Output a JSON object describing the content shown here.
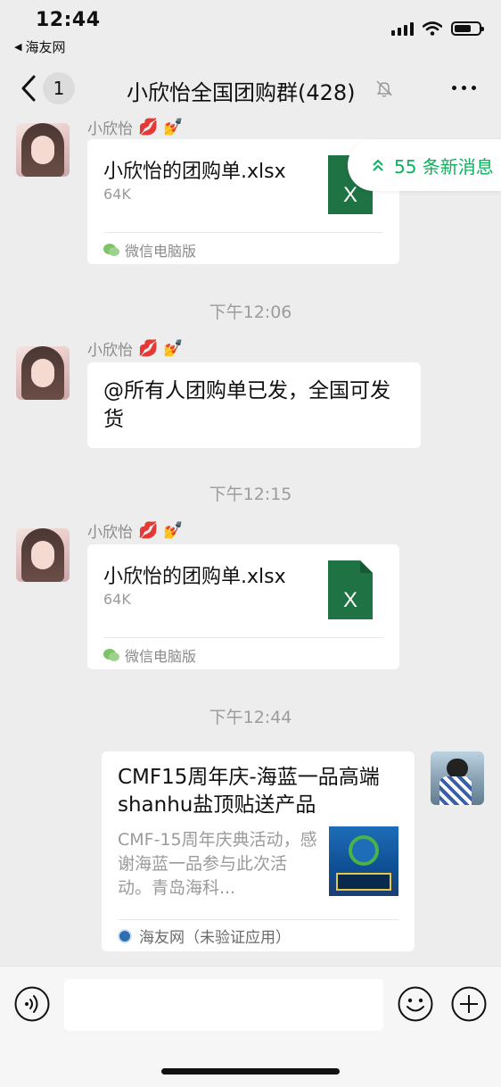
{
  "status_bar": {
    "time": "12:44",
    "back_app": "海友网",
    "back_app_icon": "left-triangle-icon",
    "icons": [
      "signal-icon",
      "wifi-icon",
      "battery-icon"
    ]
  },
  "nav": {
    "unread_count": "1",
    "title": "小欣怡全国团购群(428)",
    "mute_icon": "bell-off-icon",
    "more_icon": "more-icon"
  },
  "new_messages": {
    "label": "55 条新消息",
    "color": "#07b35a"
  },
  "messages": [
    {
      "type": "file",
      "sender": "小欣怡",
      "emojis": "💋 💅",
      "file_name": "小欣怡的团购单.xlsx",
      "file_size": "64K",
      "source": "微信电脑版"
    },
    {
      "type": "time",
      "text": "下午12:06"
    },
    {
      "type": "text",
      "sender": "小欣怡",
      "emojis": "💋 💅",
      "text": "@所有人团购单已发，全国可发货"
    },
    {
      "type": "time",
      "text": "下午12:15"
    },
    {
      "type": "file",
      "sender": "小欣怡",
      "emojis": "💋 💅",
      "file_name": "小欣怡的团购单.xlsx",
      "file_size": "64K",
      "source": "微信电脑版"
    },
    {
      "type": "time",
      "text": "下午12:44"
    },
    {
      "type": "link",
      "from_self": true,
      "title": "CMF15周年庆-海蓝一品高端shanhu盐顶贴送产品",
      "description": "CMF-15周年庆典活动，感谢海蓝一品参与此次活动。青岛海科...",
      "source": "海友网（未验证应用）"
    }
  ],
  "input_bar": {
    "placeholder": "",
    "voice_icon": "voice-icon",
    "emoji_icon": "emoji-icon",
    "plus_icon": "plus-icon"
  },
  "colors": {
    "accent_green": "#07b35a",
    "excel_green": "#1f7244",
    "background": "#ededed"
  }
}
